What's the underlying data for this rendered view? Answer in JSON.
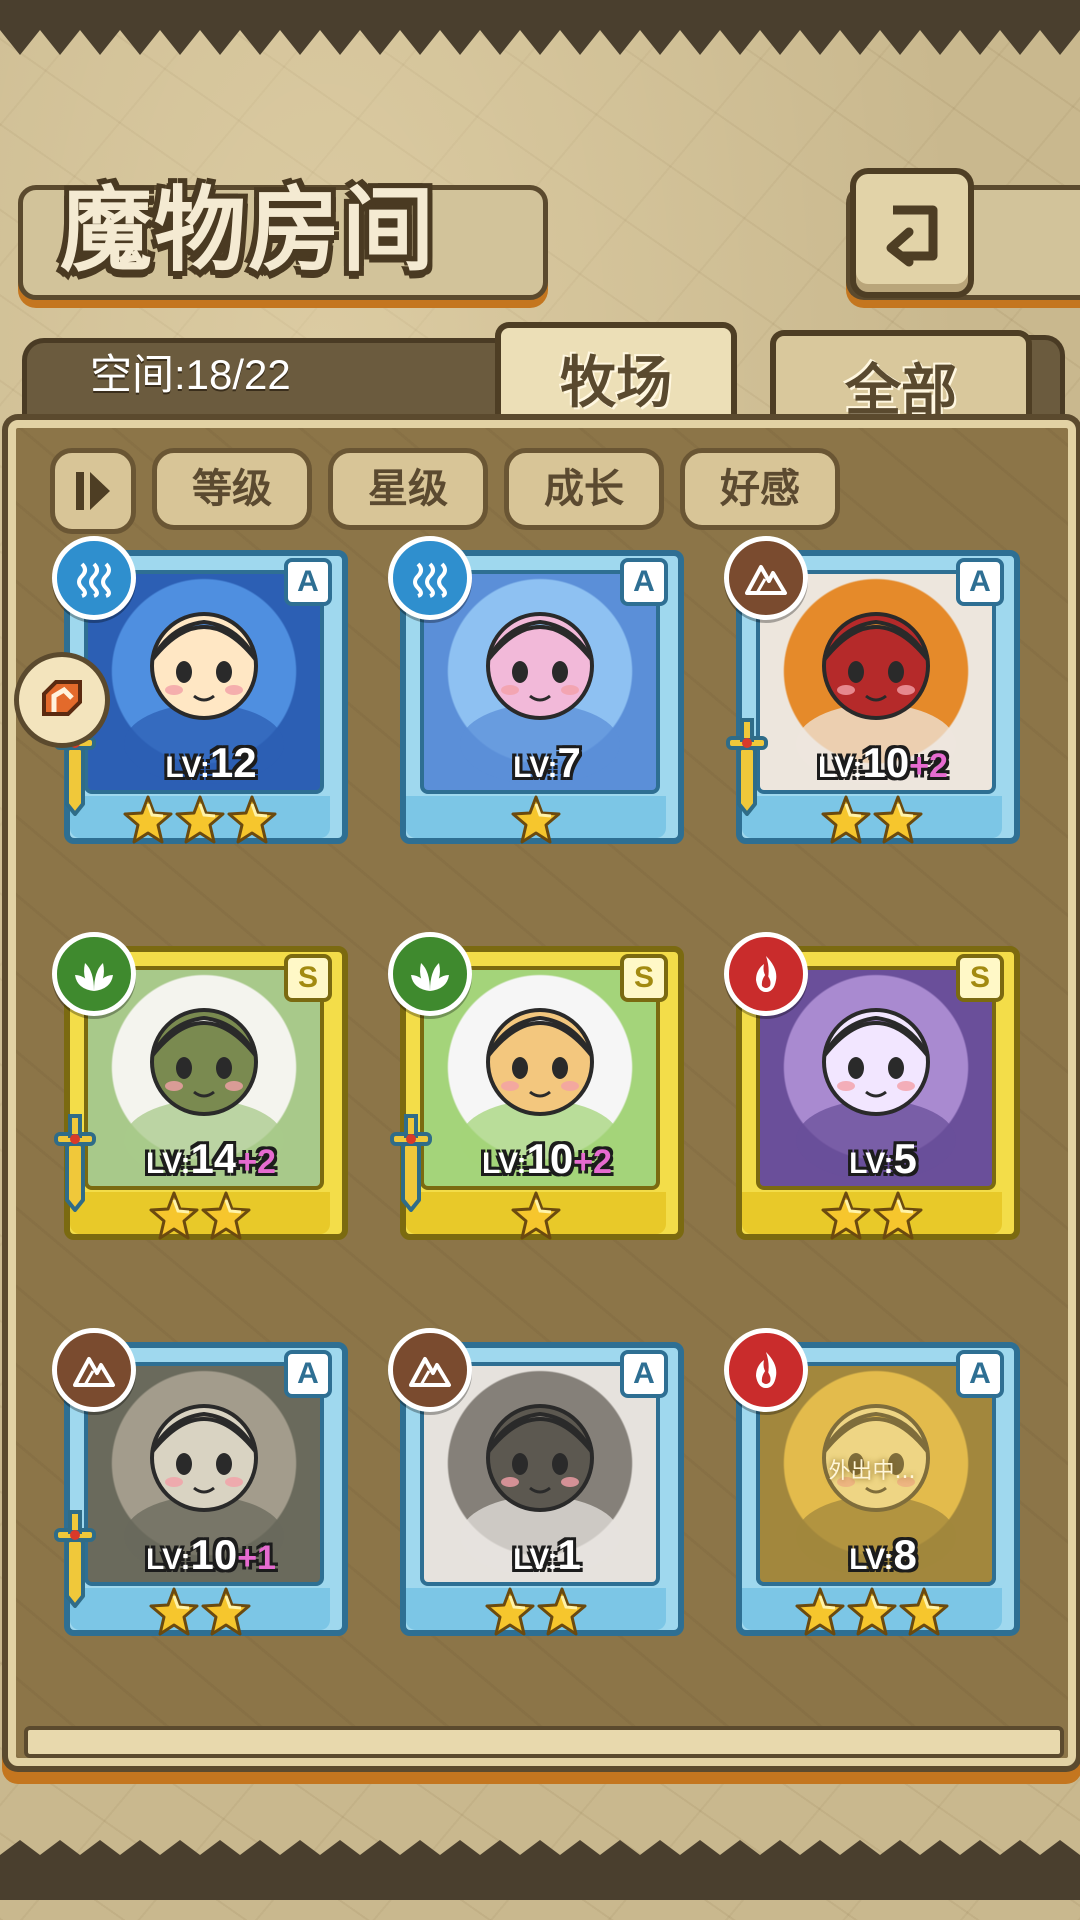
{
  "header": {
    "title": "魔物房间"
  },
  "tabs": {
    "space_text": "空间:18/22",
    "ranch": "牧场",
    "all": "全部",
    "active": "牧场"
  },
  "sort": {
    "options": [
      "等级",
      "星级",
      "成长",
      "好感"
    ]
  },
  "colors": {
    "water": "#2f8fce",
    "earth": "#7a4b2f",
    "nature": "#3f8a2e",
    "fire": "#c92c2c",
    "rank_A_frame": "#9fd8ee",
    "rank_S_frame": "#f3dd49",
    "level_bonus": "#e66bd0"
  },
  "monsters": [
    {
      "rank": "A",
      "element": "water",
      "element_icon": "water-waves-icon",
      "level_label": "LV:",
      "level": "12",
      "bonus": "",
      "stars": 3,
      "equipped": true,
      "status": "",
      "art": "blue-cat-girl"
    },
    {
      "rank": "A",
      "element": "water",
      "element_icon": "water-waves-icon",
      "level_label": "LV:",
      "level": "7",
      "bonus": "",
      "stars": 1,
      "equipped": false,
      "status": "",
      "art": "blue-slime-girl"
    },
    {
      "rank": "A",
      "element": "earth",
      "element_icon": "mountain-icon",
      "level_label": "LV:",
      "level": "10",
      "bonus": "+2",
      "stars": 2,
      "equipped": true,
      "status": "",
      "art": "scarecrow-girl"
    },
    {
      "rank": "S",
      "element": "nature",
      "element_icon": "leaf-icon",
      "level_label": "LV:",
      "level": "14",
      "bonus": "+2",
      "stars": 2,
      "equipped": true,
      "status": "",
      "art": "radish-girl"
    },
    {
      "rank": "S",
      "element": "nature",
      "element_icon": "leaf-icon",
      "level_label": "LV:",
      "level": "10",
      "bonus": "+2",
      "stars": 1,
      "equipped": true,
      "status": "",
      "art": "fairy-on-cloud"
    },
    {
      "rank": "S",
      "element": "fire",
      "element_icon": "flame-icon",
      "level_label": "LV:",
      "level": "5",
      "bonus": "",
      "stars": 2,
      "equipped": false,
      "status": "",
      "art": "moth-girl"
    },
    {
      "rank": "A",
      "element": "earth",
      "element_icon": "mountain-icon",
      "level_label": "LV:",
      "level": "10",
      "bonus": "+1",
      "stars": 2,
      "equipped": true,
      "status": "",
      "art": "rock-golem-girl"
    },
    {
      "rank": "A",
      "element": "earth",
      "element_icon": "mountain-icon",
      "level_label": "LV:",
      "level": "1",
      "bonus": "",
      "stars": 2,
      "equipped": false,
      "status": "",
      "art": "beast-rider-girl"
    },
    {
      "rank": "A",
      "element": "fire",
      "element_icon": "flame-icon",
      "level_label": "LV:",
      "level": "8",
      "bonus": "",
      "stars": 3,
      "equipped": false,
      "status": "外出中...",
      "art": "thunder-beast"
    }
  ]
}
